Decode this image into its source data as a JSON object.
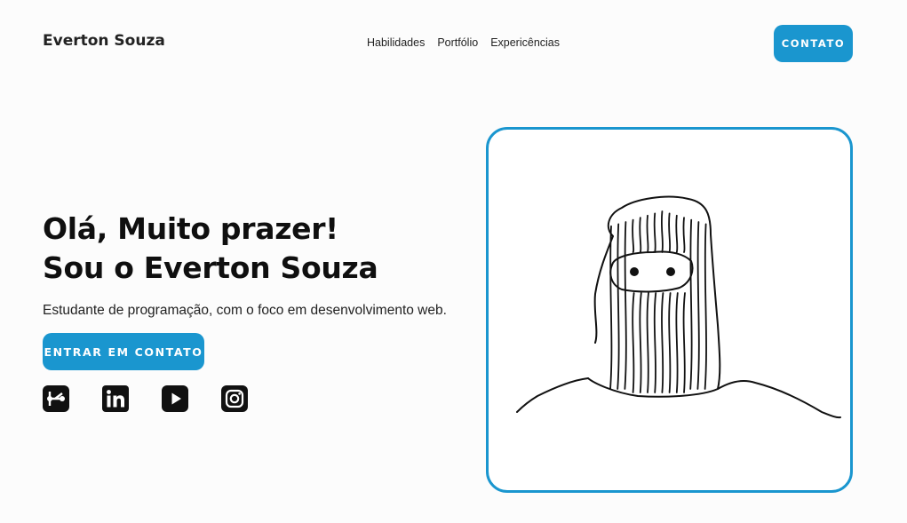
{
  "header": {
    "brand": "Everton Souza",
    "nav": [
      "Habilidades",
      "Portfólio",
      "Expericências"
    ],
    "contact_button": "CONTATO"
  },
  "hero": {
    "title_line1": "Olá, Muito prazer!",
    "title_line2": "Sou o Everton Souza",
    "subtitle": "Estudante de programação, com o foco em desenvolvimento web.",
    "cta_button": "ENTRAR EM CONTATO"
  },
  "social": {
    "icons": [
      "git-icon",
      "linkedin-icon",
      "youtube-icon",
      "instagram-icon"
    ]
  },
  "colors": {
    "accent": "#1a96cf",
    "text": "#111111",
    "background": "#fcfcfc"
  }
}
